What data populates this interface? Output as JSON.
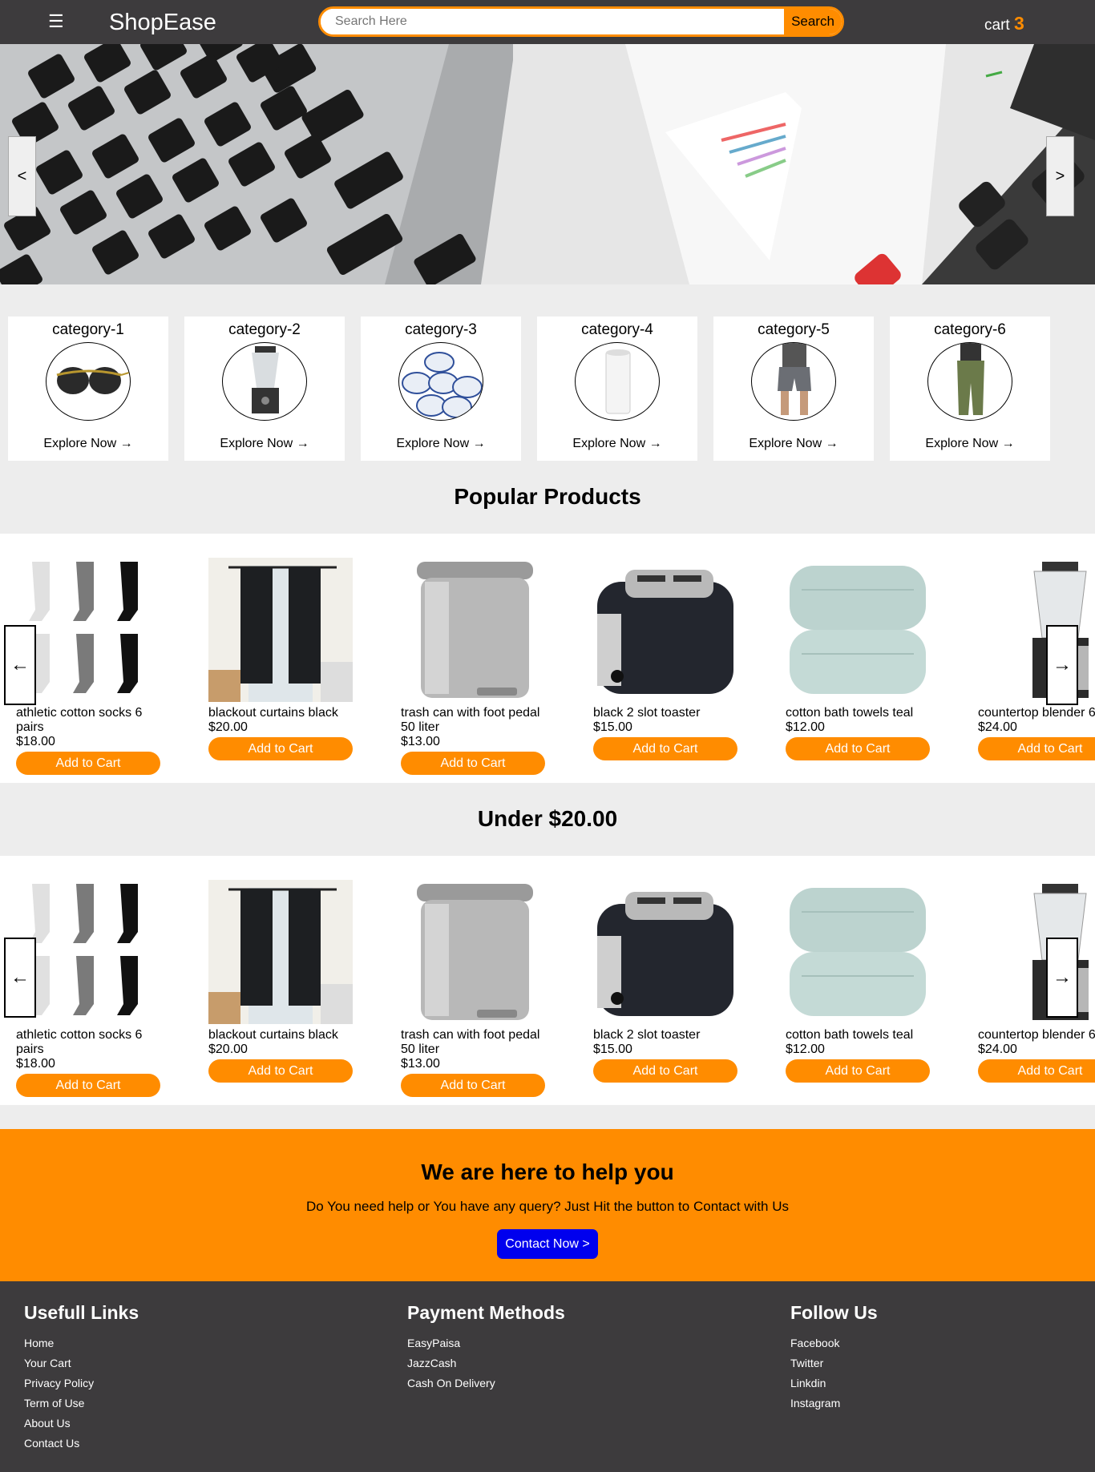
{
  "header": {
    "menu_icon": "☰",
    "brand": "ShopEase",
    "search_placeholder": "Search Here",
    "search_button": "Search",
    "cart_label": "cart",
    "cart_count": "3"
  },
  "hero": {
    "prev": "<",
    "next": ">"
  },
  "categories": [
    {
      "name": "category-1",
      "cta": "Explore Now →"
    },
    {
      "name": "category-2",
      "cta": "Explore Now →"
    },
    {
      "name": "category-3",
      "cta": "Explore Now →"
    },
    {
      "name": "category-4",
      "cta": "Explore Now →"
    },
    {
      "name": "category-5",
      "cta": "Explore Now →"
    },
    {
      "name": "category-6",
      "cta": "Explore Now →"
    }
  ],
  "popular": {
    "title": "Popular Products",
    "prev": "←",
    "next": "→",
    "products": [
      {
        "name": "athletic cotton socks 6 pairs",
        "price": "$18.00",
        "cta": "Add to Cart"
      },
      {
        "name": "blackout curtains black",
        "price": "$20.00",
        "cta": "Add to Cart"
      },
      {
        "name": "trash can with foot pedal 50 liter",
        "price": "$13.00",
        "cta": "Add to Cart"
      },
      {
        "name": "black 2 slot toaster",
        "price": "$15.00",
        "cta": "Add to Cart"
      },
      {
        "name": "cotton bath towels teal",
        "price": "$12.00",
        "cta": "Add to Cart"
      },
      {
        "name": "countertop blender 6",
        "price": "$24.00",
        "cta": "Add to Cart"
      }
    ]
  },
  "under": {
    "title": "Under $20.00",
    "prev": "←",
    "next": "→",
    "products": [
      {
        "name": "athletic cotton socks 6 pairs",
        "price": "$18.00",
        "cta": "Add to Cart"
      },
      {
        "name": "blackout curtains black",
        "price": "$20.00",
        "cta": "Add to Cart"
      },
      {
        "name": "trash can with foot pedal 50 liter",
        "price": "$13.00",
        "cta": "Add to Cart"
      },
      {
        "name": "black 2 slot toaster",
        "price": "$15.00",
        "cta": "Add to Cart"
      },
      {
        "name": "cotton bath towels teal",
        "price": "$12.00",
        "cta": "Add to Cart"
      },
      {
        "name": "countertop blender 6",
        "price": "$24.00",
        "cta": "Add to Cart"
      }
    ]
  },
  "help": {
    "title": "We are here to help you",
    "text": "Do You need help or You have any query? Just Hit the button to Contact with Us",
    "button": "Contact Now >"
  },
  "footer": {
    "links": {
      "title": "Usefull Links",
      "items": [
        "Home",
        "Your Cart",
        "Privacy Policy",
        "Term of Use",
        "About Us",
        "Contact Us"
      ]
    },
    "payment": {
      "title": "Payment Methods",
      "items": [
        "EasyPaisa",
        "JazzCash",
        "Cash On Delivery"
      ]
    },
    "follow": {
      "title": "Follow Us",
      "items": [
        "Facebook",
        "Twitter",
        "Linkdin",
        "Instagram"
      ]
    }
  },
  "colors": {
    "header": "#3d3b3d",
    "accent": "#ff8c00",
    "contact_button": "#0000ee",
    "page_bg": "#ededed"
  }
}
